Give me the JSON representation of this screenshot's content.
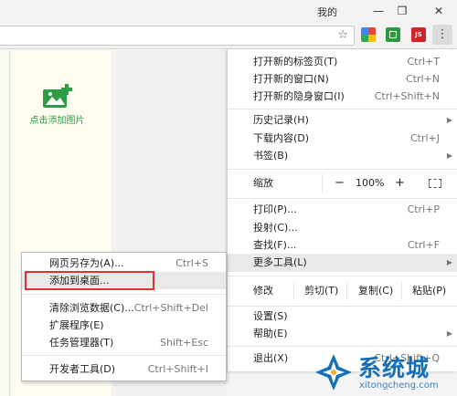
{
  "titlebar": {
    "user": "我的",
    "minimize_glyph": "—",
    "restore_glyph": "❐",
    "close_glyph": "✕"
  },
  "toolbar": {
    "star_icon": "star-icon",
    "star_glyph": "☆",
    "extensions": [
      "google-colors-icon",
      "green-square-icon",
      "js-icon"
    ],
    "js_label": "JS",
    "menu_glyph": "⋮"
  },
  "page": {
    "add_picture_label": "点击添加图片",
    "add_picture_color": "#2e9b45"
  },
  "main_menu": {
    "group1": [
      {
        "label": "打开新的标签页(T)",
        "shortcut": "Ctrl+T"
      },
      {
        "label": "打开新的窗口(N)",
        "shortcut": "Ctrl+N"
      },
      {
        "label": "打开新的隐身窗口(I)",
        "shortcut": "Ctrl+Shift+N"
      }
    ],
    "group2": [
      {
        "label": "历史记录(H)",
        "shortcut": "",
        "has_submenu": true
      },
      {
        "label": "下载内容(D)",
        "shortcut": "Ctrl+J"
      },
      {
        "label": "书签(B)",
        "shortcut": "",
        "has_submenu": true
      }
    ],
    "zoom": {
      "label": "缩放",
      "minus": "−",
      "value": "100%",
      "plus": "+"
    },
    "group3": [
      {
        "label": "打印(P)...",
        "shortcut": "Ctrl+P"
      },
      {
        "label": "投射(C)...",
        "shortcut": ""
      },
      {
        "label": "查找(F)...",
        "shortcut": "Ctrl+F"
      },
      {
        "label": "更多工具(L)",
        "shortcut": "",
        "has_submenu": true,
        "highlighted": true
      }
    ],
    "edit": {
      "label": "修改",
      "cut": "剪切(T)",
      "copy": "复制(C)",
      "paste": "粘贴(P)"
    },
    "group4": [
      {
        "label": "设置(S)",
        "shortcut": ""
      },
      {
        "label": "帮助(E)",
        "shortcut": "",
        "has_submenu": true
      }
    ],
    "exit": {
      "label": "退出(X)",
      "shortcut": "Ctrl+Shift+Q"
    },
    "arrow_glyph": "▶"
  },
  "submenu": {
    "items": [
      {
        "label": "网页另存为(A)...",
        "shortcut": "Ctrl+S"
      },
      {
        "label": "添加到桌面...",
        "shortcut": "",
        "highlighted": true
      },
      {
        "label": "清除浏览数据(C)...",
        "shortcut": "Ctrl+Shift+Del"
      },
      {
        "label": "扩展程序(E)",
        "shortcut": ""
      },
      {
        "label": "任务管理器(T)",
        "shortcut": "Shift+Esc"
      },
      {
        "label": "开发者工具(D)",
        "shortcut": "Ctrl+Shift+I"
      }
    ],
    "highlight_box_color": "#e03232"
  },
  "watermark": {
    "brand_cn": "系统城",
    "url": "xitongcheng.com",
    "color": "#1670b8"
  }
}
